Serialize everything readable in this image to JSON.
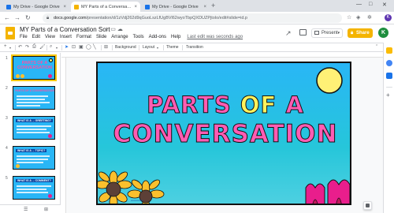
{
  "browser": {
    "tabs": [
      {
        "title": "My Drive - Google Drive",
        "favicon_color": "#1a73e8",
        "active": false
      },
      {
        "title": "MY Parts of a Conversation Sort",
        "favicon_color": "#f4b400",
        "active": true
      },
      {
        "title": "My Drive - Google Drive",
        "favicon_color": "#1a73e8",
        "active": false
      }
    ],
    "new_tab_symbol": "+",
    "close_symbol": "×",
    "url_host": "docs.google.com",
    "url_path": "/presentation/d/1zVdj262d9qGuoLszLfUgBVl62wyoTbpQXDUZPjtolo/edit#slide=id.p",
    "profile_initial": "K"
  },
  "app": {
    "doc_title": "MY Parts of a Conversation Sort",
    "menu": [
      "File",
      "Edit",
      "View",
      "Insert",
      "Format",
      "Slide",
      "Arrange",
      "Tools",
      "Add-ons",
      "Help"
    ],
    "last_edit": "Last edit was seconds ago",
    "present_label": "Present",
    "share_label": "Share",
    "user_initial": "K",
    "brand_color": "#f4b400"
  },
  "toolbar": {
    "background_label": "Background",
    "layout_label": "Layout",
    "theme_label": "Theme",
    "transition_label": "Transition"
  },
  "filmstrip": {
    "slides": [
      {
        "number": "1",
        "title": "PARTS OF A CONVERSATION",
        "selected": true
      },
      {
        "number": "2",
        "title": "PARTS OF A CONVERSATION",
        "selected": false
      },
      {
        "number": "3",
        "title": "WHAT IS A ... GREETING?",
        "selected": false
      },
      {
        "number": "4",
        "title": "WHAT IS A ... TOPIC?",
        "selected": false
      },
      {
        "number": "5",
        "title": "WHAT IS A ... COMMENT?",
        "selected": false
      }
    ]
  },
  "slide": {
    "title_line1_a": "PARTS",
    "title_line1_b": "OF",
    "title_line1_c": "A",
    "title_line2": "CONVERSATION",
    "title_pink": "#ff5cb3",
    "title_yellow": "#fff35c"
  }
}
